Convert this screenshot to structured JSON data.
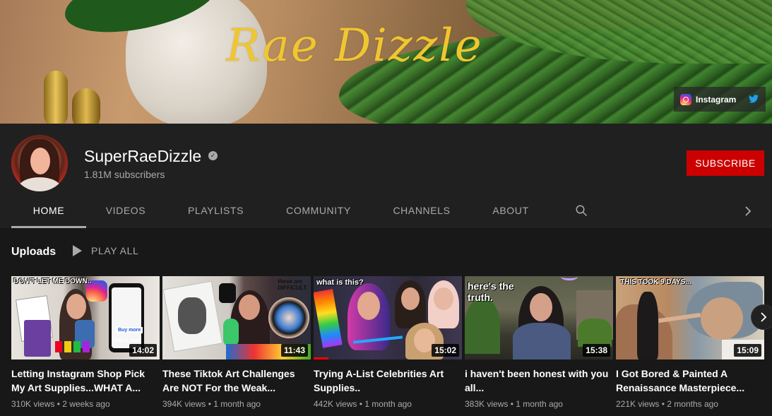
{
  "banner": {
    "title": "Rae Dizzle",
    "social": {
      "instagram_label": "Instagram"
    }
  },
  "channel": {
    "name": "SuperRaeDizzle",
    "subscribers": "1.81M subscribers",
    "subscribe_label": "SUBSCRIBE",
    "verified_glyph": "✓"
  },
  "tabs": [
    {
      "label": "HOME",
      "active": true
    },
    {
      "label": "VIDEOS"
    },
    {
      "label": "PLAYLISTS"
    },
    {
      "label": "COMMUNITY"
    },
    {
      "label": "CHANNELS"
    },
    {
      "label": "ABOUT"
    }
  ],
  "uploads": {
    "title": "Uploads",
    "play_all": "PLAY ALL"
  },
  "videos": [
    {
      "title": "Letting Instagram Shop Pick My Art Supplies...WHAT A...",
      "views": "310K views",
      "age": "2 weeks ago",
      "duration": "14:02",
      "thumb_text": [
        "DON'T LET ME DOWN..",
        "Add to cart",
        "Buy more"
      ],
      "progress": 0
    },
    {
      "title": "These Tiktok Art Challenges Are NOT For the Weak...",
      "views": "394K views",
      "age": "1 month ago",
      "duration": "11:43",
      "thumb_text": [
        "these are DIFFICULT."
      ],
      "progress": 0
    },
    {
      "title": "Trying A-List Celebrities Art Supplies..",
      "views": "442K views",
      "age": "1 month ago",
      "duration": "15:02",
      "thumb_text": [
        "what is this?"
      ],
      "progress": 0.1
    },
    {
      "title": "i haven't been honest with you all...",
      "views": "383K views",
      "age": "1 month ago",
      "duration": "15:38",
      "thumb_text": [
        "here's the truth."
      ],
      "progress": 0
    },
    {
      "title": "I Got Bored & Painted A Renaissance Masterpiece...",
      "views": "221K views",
      "age": "2 months ago",
      "duration": "15:09",
      "thumb_text": [
        "THIS TOOK 9 DAYS..."
      ],
      "progress": 0
    }
  ],
  "meta_separator": "•",
  "colors": {
    "subscribe_bg": "#cc0000",
    "page_bg": "#181818",
    "header_bg": "#202020",
    "progress": "#ff0000"
  }
}
